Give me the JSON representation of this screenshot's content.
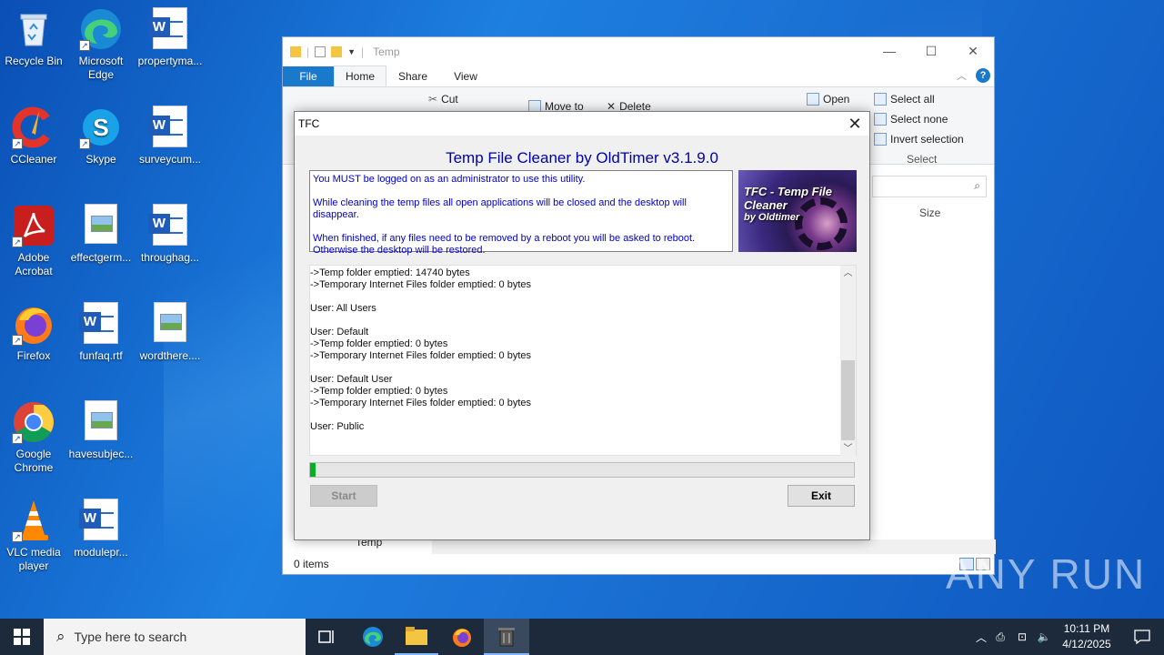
{
  "desktop": {
    "icons": [
      {
        "label": "Recycle Bin"
      },
      {
        "label": "Microsoft Edge"
      },
      {
        "label": "propertyma..."
      },
      {
        "label": "CCleaner"
      },
      {
        "label": "Skype"
      },
      {
        "label": "surveycum..."
      },
      {
        "label": "Adobe Acrobat"
      },
      {
        "label": "effectgerm..."
      },
      {
        "label": "throughag..."
      },
      {
        "label": "Firefox"
      },
      {
        "label": "funfaq.rtf"
      },
      {
        "label": "wordthere...."
      },
      {
        "label": "Google Chrome"
      },
      {
        "label": "havesubjec..."
      },
      {
        "label": "VLC media player"
      },
      {
        "label": "modulepr..."
      }
    ]
  },
  "explorer": {
    "title": "Temp",
    "tabs": [
      "File",
      "Home",
      "Share",
      "View"
    ],
    "ribbon": {
      "cut": "Cut",
      "move_to": "Move to",
      "delete": "Delete",
      "open": "Open",
      "select_all": "Select all",
      "select_none": "Select none",
      "invert_selection": "Invert selection",
      "select_group": "Select"
    },
    "column_size": "Size",
    "nav_folder": "Temp",
    "status": "0 items"
  },
  "tfc": {
    "window_title": "TFC",
    "heading": "Temp File Cleaner by OldTimer v3.1.9.0",
    "info": [
      "You MUST be logged on as an administrator to use this utility.",
      "While cleaning the temp files all open applications will be closed and the desktop will disappear.",
      "When finished, if any files need to be removed by a reboot you will be asked to reboot.",
      "Otherwise the desktop will be restored."
    ],
    "logo_title": "TFC - Temp File Cleaner",
    "logo_sub": "by Oldtimer",
    "log_lines": [
      "->Temp folder emptied: 14740 bytes",
      "->Temporary Internet Files folder emptied: 0 bytes",
      "",
      "User: All Users",
      "",
      "User: Default",
      "->Temp folder emptied: 0 bytes",
      "->Temporary Internet Files folder emptied: 0 bytes",
      "",
      "User: Default User",
      "->Temp folder emptied: 0 bytes",
      "->Temporary Internet Files folder emptied: 0 bytes",
      "",
      "User: Public"
    ],
    "progress": 0.01,
    "start_label": "Start",
    "exit_label": "Exit"
  },
  "taskbar": {
    "search_placeholder": "Type here to search",
    "time": "10:11 PM",
    "date": "4/12/2025"
  },
  "watermark": "ANY RUN",
  "colors": {
    "heading_blue": "#0000a8",
    "info_blue": "#0000c8",
    "progress_green": "#06b025",
    "file_tab_blue": "#1979ca"
  }
}
